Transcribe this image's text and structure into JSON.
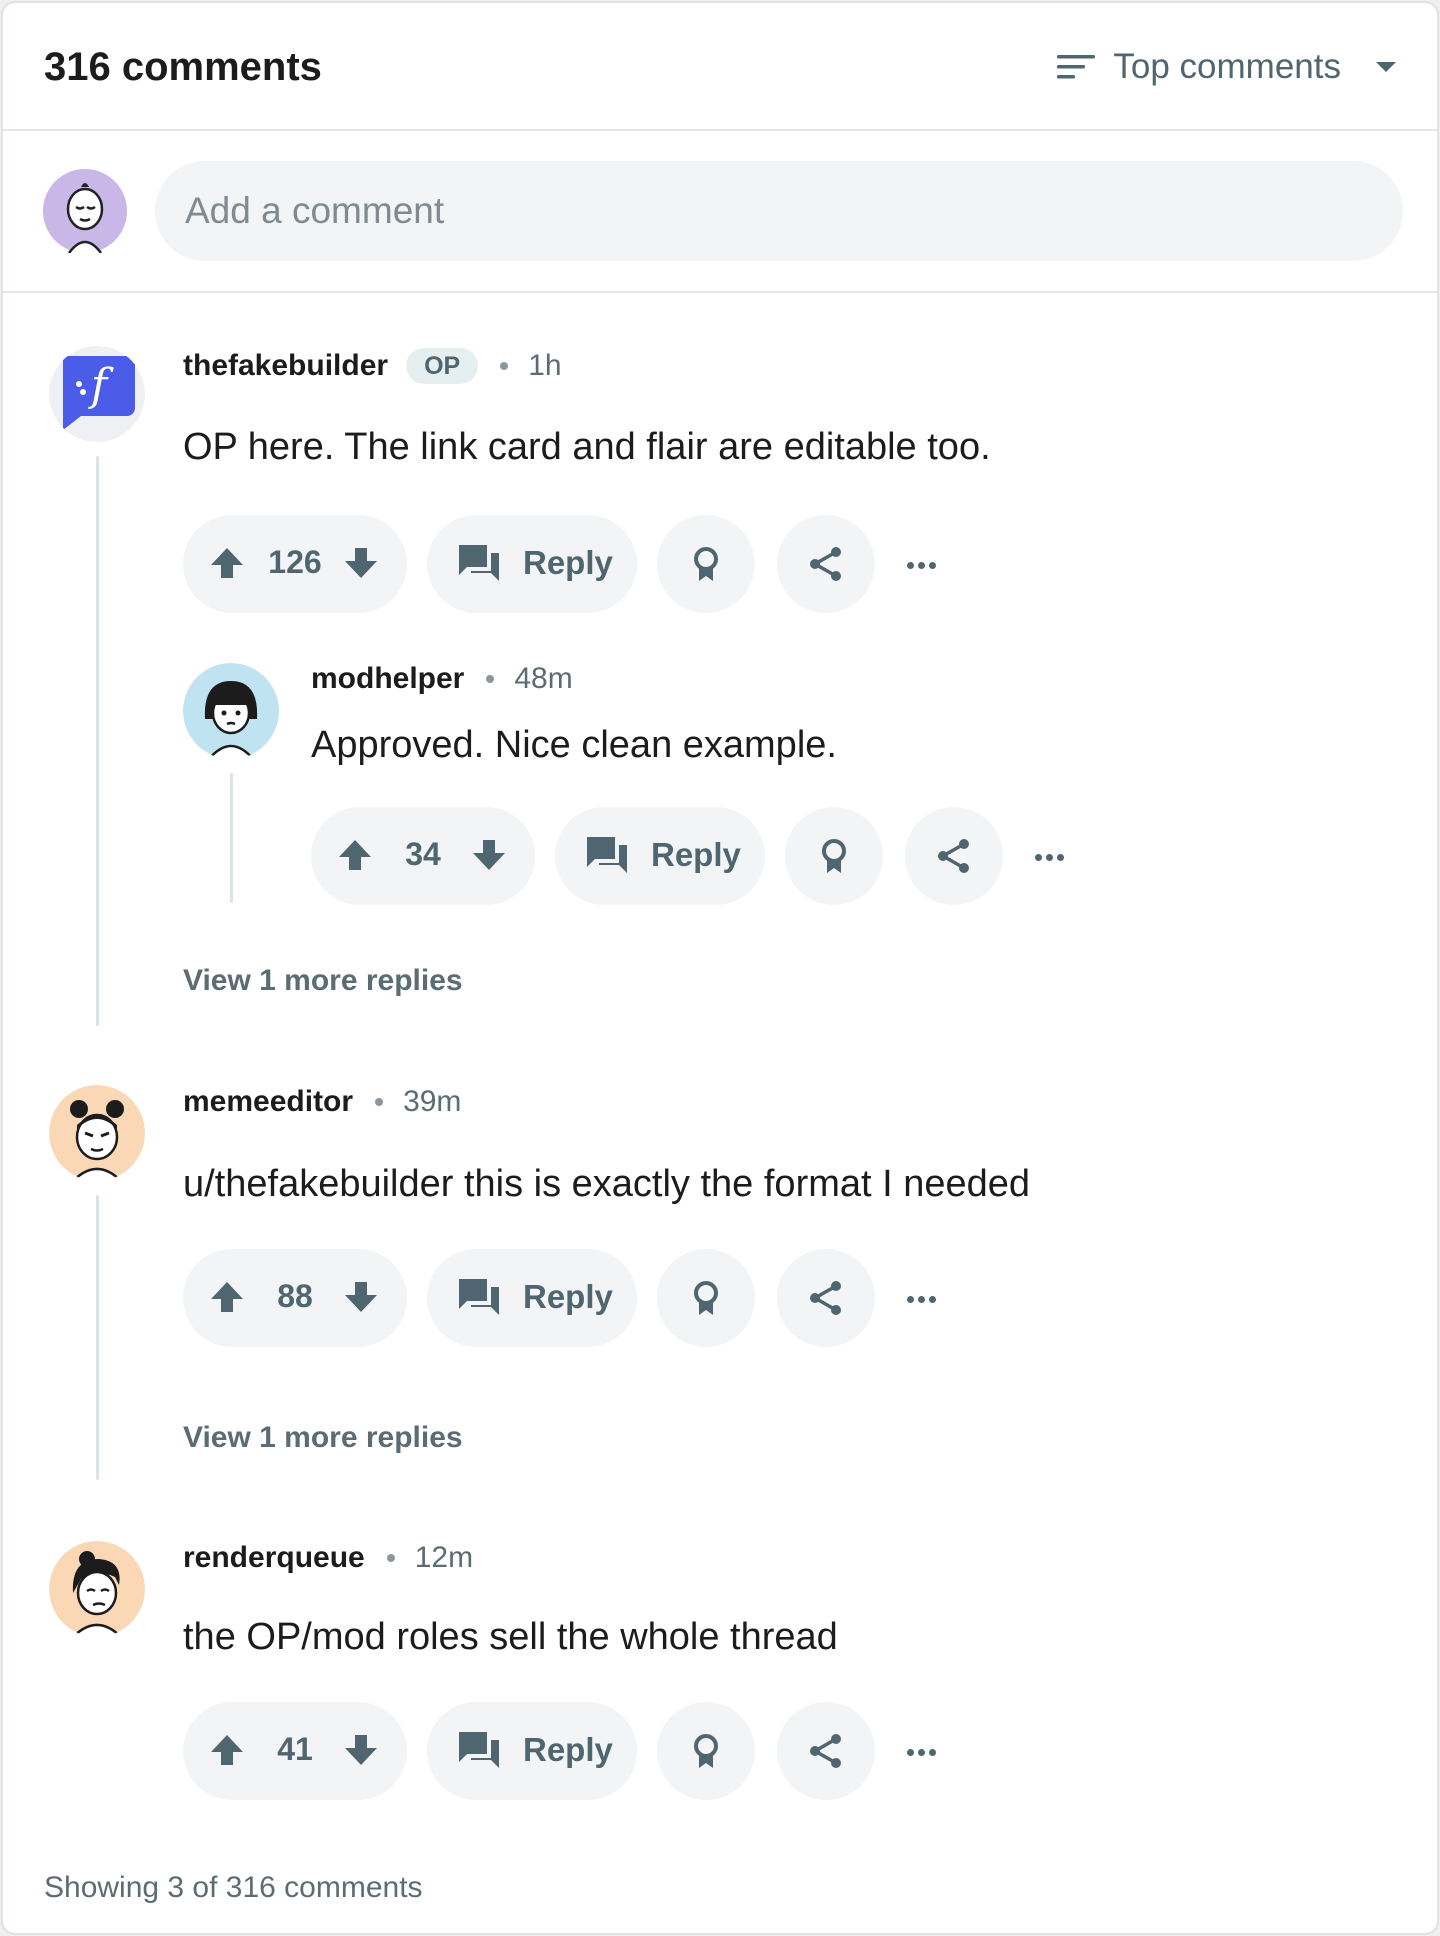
{
  "header": {
    "title": "316 comments",
    "sort_label": "Top comments"
  },
  "composer": {
    "placeholder": "Add a comment"
  },
  "comments": [
    {
      "author": "thefakebuilder",
      "badge": "OP",
      "time": "1h",
      "body": "OP here. The link card and flair are editable too.",
      "votes": "126",
      "reply_label": "Reply",
      "replies": [
        {
          "author": "modhelper",
          "time": "48m",
          "body": "Approved. Nice clean example.",
          "votes": "34",
          "reply_label": "Reply"
        }
      ],
      "view_more": "View 1 more replies"
    },
    {
      "author": "memeeditor",
      "time": "39m",
      "body": "u/thefakebuilder this is exactly the format I needed",
      "votes": "88",
      "reply_label": "Reply",
      "view_more": "View 1 more replies"
    },
    {
      "author": "renderqueue",
      "time": "12m",
      "body": "the OP/mod roles sell the whole thread",
      "votes": "41",
      "reply_label": "Reply"
    }
  ],
  "footer": {
    "status": "Showing 3 of 316 comments"
  },
  "colors": {
    "accent_icon_bg": "#4b5de8",
    "pill_bg": "#f2f4f5",
    "muted_text": "#4f6670",
    "thread_line": "#dbe3e7"
  }
}
